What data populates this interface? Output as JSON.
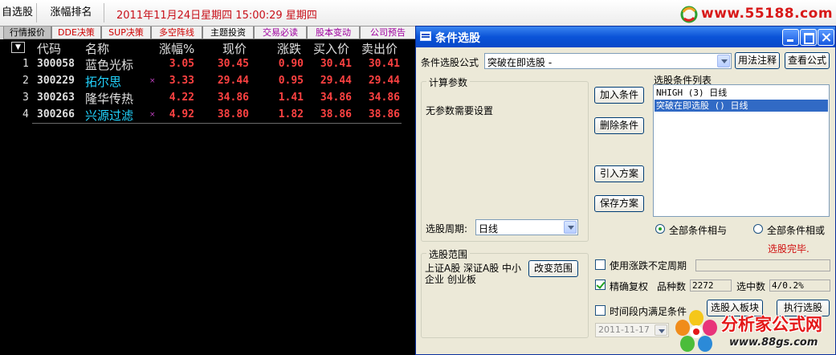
{
  "topbar": {
    "zixuan": "自选股",
    "zhangfu": "涨幅排名",
    "datetime": "2011年11月24日星期四  15:00:29 星期四",
    "site_url": "www.55188.com"
  },
  "tabs": [
    {
      "label": "行情报价",
      "color": "#000000",
      "active": true
    },
    {
      "label": "DDE决策",
      "color": "#d00000"
    },
    {
      "label": "SUP决策",
      "color": "#d00000"
    },
    {
      "label": "多空阵线",
      "color": "#d00000"
    },
    {
      "label": "主题投资",
      "color": "#000000"
    },
    {
      "label": "交易必读",
      "color": "#a000a0"
    },
    {
      "label": "股本变动",
      "color": "#a000a0"
    },
    {
      "label": "公司预告",
      "color": "#a000a0"
    }
  ],
  "quote": {
    "headers": [
      "代码",
      "名称",
      "涨幅%",
      "现价",
      "涨跌",
      "买入价",
      "卖出价"
    ],
    "sort_icon": "▼",
    "rows": [
      {
        "idx": "1",
        "code": "300058",
        "name": "蓝色光标",
        "name_color": "#e0e0e0",
        "mark": "",
        "pct": "3.05",
        "price": "30.45",
        "chg": "0.90",
        "bid": "30.41",
        "ask": "30.41"
      },
      {
        "idx": "2",
        "code": "300229",
        "name": "拓尔思",
        "name_color": "#22d4ff",
        "mark": "×",
        "pct": "3.33",
        "price": "29.44",
        "chg": "0.95",
        "bid": "29.44",
        "ask": "29.44"
      },
      {
        "idx": "3",
        "code": "300263",
        "name": "隆华传热",
        "name_color": "#e0e0e0",
        "mark": "",
        "pct": "4.22",
        "price": "34.86",
        "chg": "1.41",
        "bid": "34.86",
        "ask": "34.86"
      },
      {
        "idx": "4",
        "code": "300266",
        "name": "兴源过滤",
        "name_color": "#22d4ff",
        "mark": "×",
        "pct": "4.92",
        "price": "38.80",
        "chg": "1.82",
        "bid": "38.86",
        "ask": "38.86"
      }
    ]
  },
  "dialog": {
    "title": "条件选股",
    "formula_label": "条件选股公式",
    "formula_value": "突破在即选股 -",
    "usage_btn": "用法注释",
    "view_btn": "查看公式",
    "params_group": "计算参数",
    "params_text": "无参数需要设置",
    "period_label": "选股周期:",
    "period_value": "日线",
    "add_btn": "加入条件",
    "del_btn": "删除条件",
    "import_btn": "引入方案",
    "save_btn": "保存方案",
    "cond_list_label": "选股条件列表",
    "cond_list": [
      "NHIGH (3) 日线",
      "突破在即选股 () 日线"
    ],
    "radio_and": "全部条件相与",
    "radio_or": "全部条件相或",
    "status": "选股完毕.",
    "scope_group": "选股范围",
    "scope_text": "上证A股 深证A股 中小企业 创业板",
    "scope_btn": "改变范围",
    "opt_period": "使用涨跌不定周期",
    "opt_fq": "精确复权",
    "count_label": "品种数",
    "count_value": "2272",
    "selected_label": "选中数",
    "selected_value": "4/0.2%",
    "opt_time": "时间段内满足条件",
    "to_block_btn": "选股入板块",
    "run_btn": "执行选股",
    "date_value": "2011-11-17"
  },
  "watermark": {
    "text": "分析家公式网",
    "url": "www.88gs.com"
  }
}
